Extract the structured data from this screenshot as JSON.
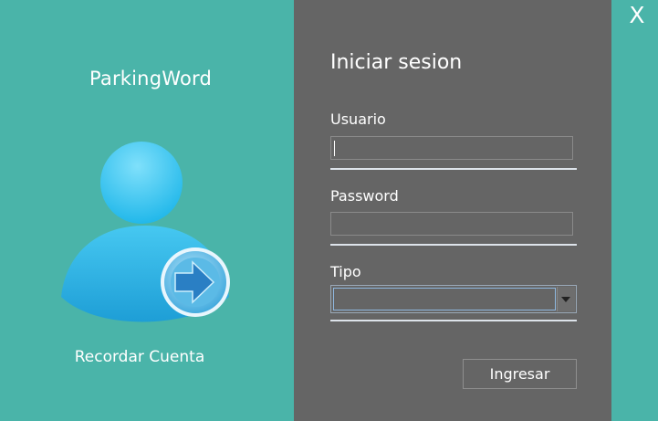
{
  "window": {
    "close_label": "X"
  },
  "branding": {
    "app_name": "ParkingWord",
    "avatar_icon": "user-login-icon"
  },
  "remember": {
    "label": "Recordar Cuenta"
  },
  "login": {
    "title": "Iniciar sesion",
    "username_label": "Usuario",
    "username_value": "",
    "password_label": "Password",
    "password_value": "",
    "type_label": "Tipo",
    "type_value": "",
    "submit_label": "Ingresar"
  },
  "colors": {
    "teal": "#4ab4a9",
    "panel": "#656565",
    "avatar_blue": "#2aa8e0",
    "text": "#ffffff"
  }
}
